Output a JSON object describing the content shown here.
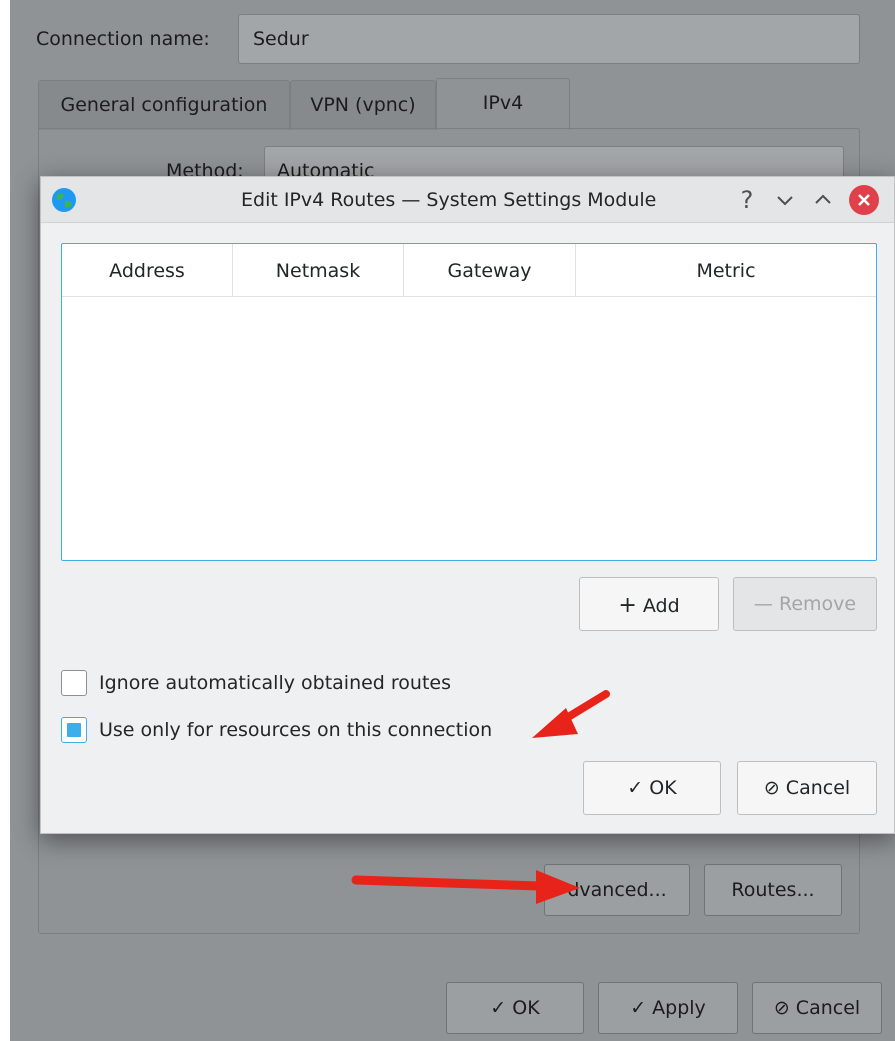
{
  "parent": {
    "connection_name_label": "Connection name:",
    "connection_name_value": "Sedur",
    "tabs": [
      {
        "label": "General configuration"
      },
      {
        "label": "VPN (vpnc)"
      },
      {
        "label": "IPv4"
      }
    ],
    "method_label": "Method:",
    "method_value": "Automatic",
    "advanced_button": "dvanced...",
    "routes_button": "Routes...",
    "ok_button": "OK",
    "apply_button": "Apply",
    "cancel_button": "Cancel"
  },
  "dialog": {
    "title": "Edit IPv4 Routes — System Settings Module",
    "columns": [
      "Address",
      "Netmask",
      "Gateway",
      "Metric"
    ],
    "add_button": "Add",
    "remove_button": "Remove",
    "ignore_routes_label": "Ignore automatically obtained routes",
    "ignore_routes_checked": false,
    "use_only_label": "Use only for resources on this connection",
    "use_only_checked": true,
    "ok_button": "OK",
    "cancel_button": "Cancel"
  },
  "colors": {
    "accent": "#3daee9",
    "close": "#e0404a",
    "annotation": "#e8231a"
  },
  "icons": [
    "globe-icon",
    "help-icon",
    "minimize-icon",
    "maximize-icon",
    "close-icon",
    "plus-icon",
    "minus-icon",
    "check-icon",
    "cancel-icon"
  ]
}
